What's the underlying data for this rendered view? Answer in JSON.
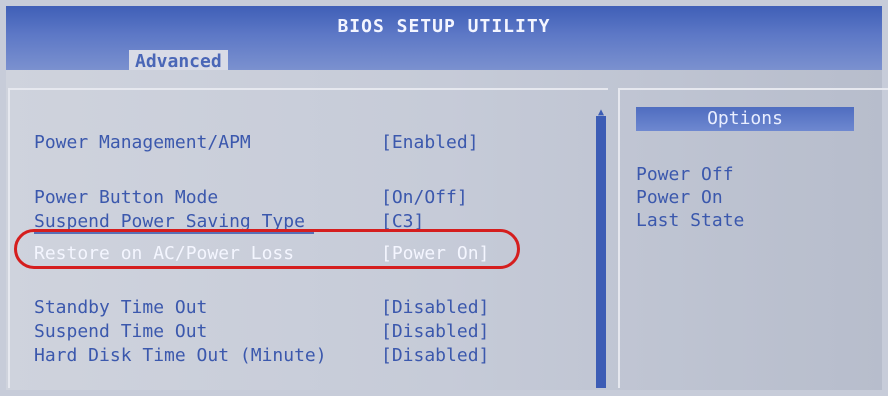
{
  "header": {
    "title": "BIOS SETUP UTILITY",
    "active_tab": "Advanced"
  },
  "settings": [
    {
      "label": "Power Management/APM",
      "value": "[Enabled]"
    },
    {
      "label": "Power Button Mode",
      "value": "[On/Off]"
    },
    {
      "label": "Suspend Power Saving Type",
      "value": "[C3]"
    },
    {
      "label": "Restore on AC/Power Loss",
      "value": "[Power On]"
    },
    {
      "label": "Standby Time Out",
      "value": "[Disabled]"
    },
    {
      "label": "Suspend Time Out",
      "value": "[Disabled]"
    },
    {
      "label": "Hard Disk Time Out (Minute)",
      "value": "[Disabled]"
    }
  ],
  "options_panel": {
    "title": "Options",
    "items": [
      "Power Off",
      "Power On",
      "Last State"
    ]
  },
  "colors": {
    "accent": "#3b58ad",
    "highlight_ring": "#d51e1e"
  }
}
